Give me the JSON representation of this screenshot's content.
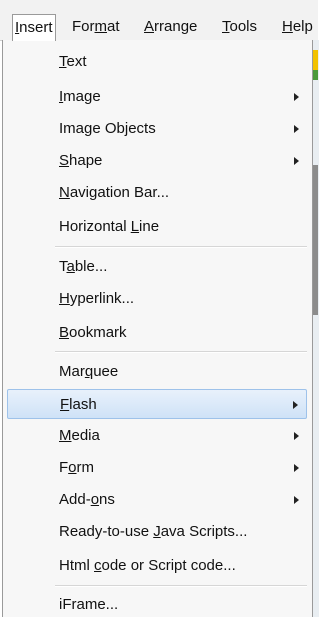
{
  "menubar": {
    "items": [
      {
        "label": "Insert"
      },
      {
        "label": "Format"
      },
      {
        "label": "Arrange"
      },
      {
        "label": "Tools"
      },
      {
        "label": "Help"
      }
    ]
  },
  "insert_menu": {
    "items": [
      {
        "label": "Text",
        "has_submenu": false
      },
      {
        "label": "Image",
        "has_submenu": true
      },
      {
        "label": "Image Objects",
        "has_submenu": true
      },
      {
        "label": "Shape",
        "has_submenu": true
      },
      {
        "label": "Navigation Bar...",
        "has_submenu": false
      },
      {
        "label": "Horizontal Line",
        "has_submenu": false
      },
      {
        "label": "Table...",
        "has_submenu": false
      },
      {
        "label": "Hyperlink...",
        "has_submenu": false
      },
      {
        "label": "Bookmark",
        "has_submenu": false
      },
      {
        "label": "Marquee",
        "has_submenu": false
      },
      {
        "label": "Flash",
        "has_submenu": true,
        "highlighted": true
      },
      {
        "label": "Media",
        "has_submenu": true
      },
      {
        "label": "Form",
        "has_submenu": true
      },
      {
        "label": "Add-ons",
        "has_submenu": true
      },
      {
        "label": "Ready-to-use Java Scripts...",
        "has_submenu": false
      },
      {
        "label": "Html code or Script code...",
        "has_submenu": false
      },
      {
        "label": "iFrame...",
        "has_submenu": false
      }
    ]
  },
  "colors": {
    "highlight": "#cfe2f7",
    "highlight_border": "#9ec2ea",
    "menu_background": "#f7f7f7"
  }
}
